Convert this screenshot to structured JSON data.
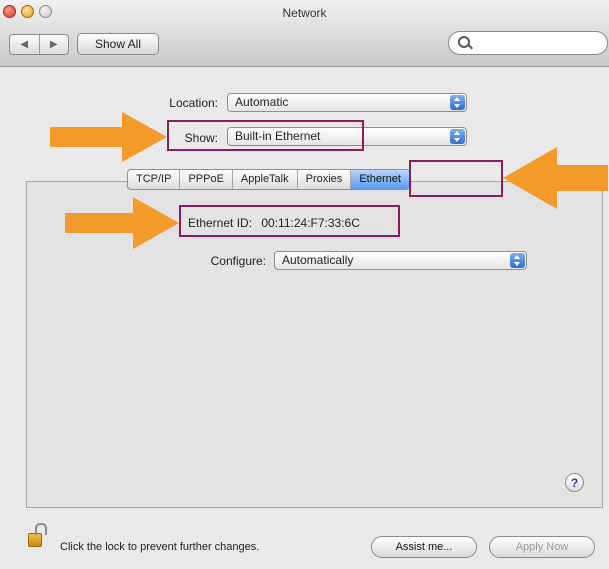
{
  "window": {
    "title": "Network"
  },
  "toolbar": {
    "back_icon": "left-triangle-icon",
    "forward_icon": "right-triangle-icon",
    "show_all_label": "Show All",
    "search_placeholder": "",
    "search_value": ""
  },
  "location": {
    "label": "Location:",
    "value": "Automatic"
  },
  "show": {
    "label": "Show:",
    "value": "Built-in Ethernet"
  },
  "tabs": [
    {
      "label": "TCP/IP"
    },
    {
      "label": "PPPoE"
    },
    {
      "label": "AppleTalk"
    },
    {
      "label": "Proxies"
    },
    {
      "label": "Ethernet",
      "selected": true
    }
  ],
  "ethernet": {
    "id_label": "Ethernet ID:",
    "id_value": "00:11:24:F7:33:6C",
    "configure_label": "Configure:",
    "configure_value": "Automatically"
  },
  "help": {
    "label": "?"
  },
  "footer": {
    "lock_text": "Click the lock to prevent further changes.",
    "assist_label": "Assist me...",
    "apply_label": "Apply Now"
  },
  "colors": {
    "highlight_box": "#8a1d5e",
    "arrow": "#f39a2a",
    "selected_tab": "#5a9af0",
    "popup_arrow": "#2f6fcf"
  }
}
